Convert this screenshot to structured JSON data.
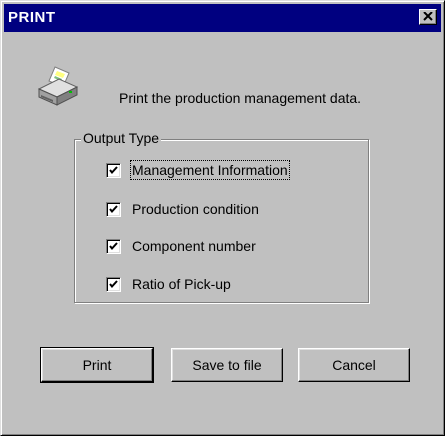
{
  "window": {
    "title": "PRINT"
  },
  "message": "Print the production management data.",
  "output_type": {
    "legend": "Output Type",
    "options": [
      {
        "label": "Management Information",
        "checked": true
      },
      {
        "label": "Production condition",
        "checked": true
      },
      {
        "label": "Component number",
        "checked": true
      },
      {
        "label": "Ratio of Pick-up",
        "checked": true
      }
    ]
  },
  "buttons": {
    "print": "Print",
    "save_to_file": "Save to file",
    "cancel": "Cancel"
  },
  "colors": {
    "title_bar": "#000080",
    "face": "#c0c0c0"
  },
  "icons": {
    "printer": "printer-icon",
    "close": "close-icon"
  }
}
